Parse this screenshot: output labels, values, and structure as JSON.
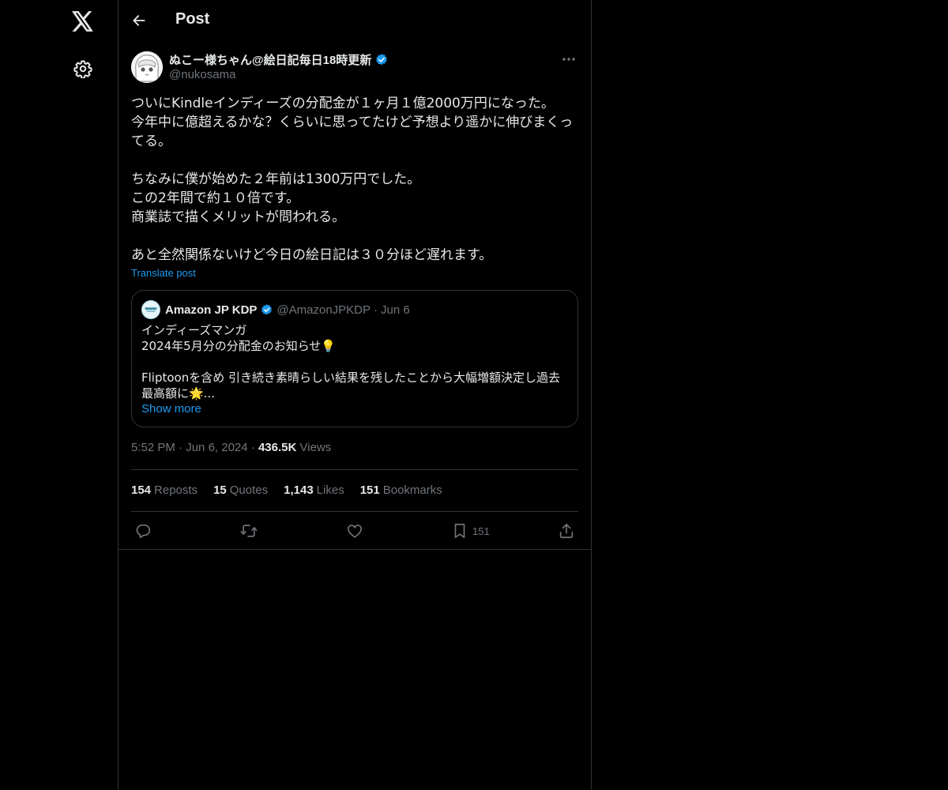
{
  "header": {
    "title": "Post"
  },
  "post": {
    "author_name": "ぬこー様ちゃん@絵日記毎日18時更新",
    "author_handle": "@nukosama",
    "text": "ついにKindleインディーズの分配金が１ヶ月１億2000万円になった。\n今年中に億超えるかな？くらいに思ってたけど予想より遥かに伸びまくってる。\n\nちなみに僕が始めた２年前は1300万円でした。\nこの2年間で約１０倍です。\n商業誌で描くメリットが問われる。\n\nあと全然関係ないけど今日の絵日記は３０分ほど遅れます。",
    "translate_label": "Translate post",
    "time": "5:52 PM",
    "date": "Jun 6, 2024",
    "views_count": "436.5K",
    "views_label": "Views"
  },
  "quote": {
    "name": "Amazon JP KDP",
    "handle": "@AmazonJPKDP",
    "date": "Jun 6",
    "text": "インディーズマンガ\n2024年5月分の分配金のお知らせ💡\n\nFliptoonを含め 引き続き素晴らしい結果を残したことから大幅増額決定し過去最高額に🌟...",
    "show_more": "Show more"
  },
  "stats": {
    "reposts_count": "154",
    "reposts_label": "Reposts",
    "quotes_count": "15",
    "quotes_label": "Quotes",
    "likes_count": "1,143",
    "likes_label": "Likes",
    "bookmarks_count": "151",
    "bookmarks_label": "Bookmarks"
  },
  "actions": {
    "bookmark_count": "151"
  },
  "icons": {
    "logo": "x-logo-icon",
    "settings": "gear-icon",
    "back": "arrow-left-icon",
    "more": "more-horizontal-icon",
    "verified": "verified-badge-icon",
    "reply": "reply-icon",
    "repost": "repost-icon",
    "like": "heart-icon",
    "bookmark": "bookmark-icon",
    "share": "share-icon"
  },
  "colors": {
    "background": "#000000",
    "text": "#e7e9ea",
    "muted": "#71767b",
    "accent": "#1d9bf0",
    "border": "#2f3336"
  }
}
